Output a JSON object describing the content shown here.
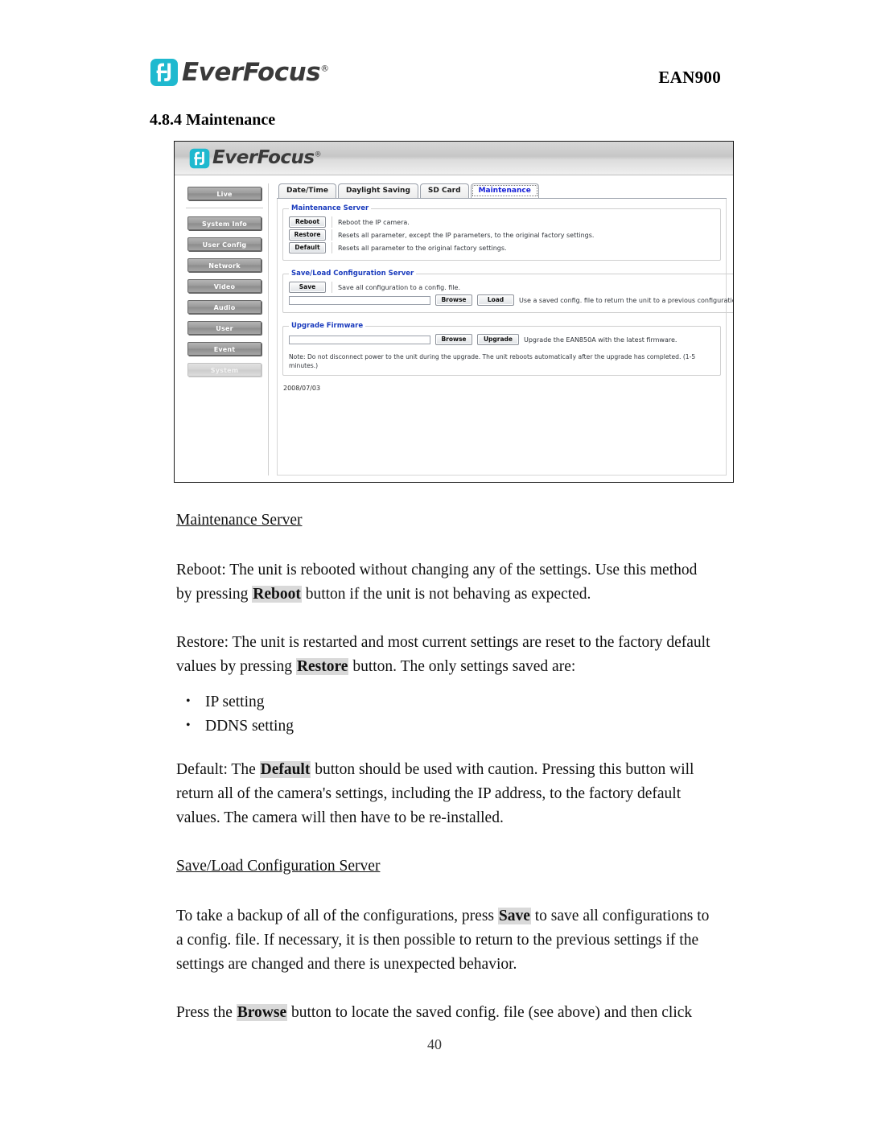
{
  "header": {
    "brand": "EverFocus",
    "brand_registered": "®",
    "model": "EAN900",
    "logo_color": "#1fb9cf"
  },
  "section": {
    "heading": "4.8.4 Maintenance"
  },
  "figure": {
    "app_brand": "EverFocus",
    "app_brand_registered": "®",
    "sidebar": [
      {
        "label": "Live",
        "active": false
      },
      {
        "label": "System Info",
        "active": false
      },
      {
        "label": "User Config",
        "active": false
      },
      {
        "label": "Network",
        "active": false
      },
      {
        "label": "Video",
        "active": false
      },
      {
        "label": "Audio",
        "active": false
      },
      {
        "label": "User",
        "active": false
      },
      {
        "label": "Event",
        "active": false
      },
      {
        "label": "System",
        "active": true
      }
    ],
    "tabs": [
      {
        "label": "Date/Time",
        "active": false
      },
      {
        "label": "Daylight Saving",
        "active": false
      },
      {
        "label": "SD Card",
        "active": false
      },
      {
        "label": "Maintenance",
        "active": true
      }
    ],
    "maintenance_server": {
      "legend": "Maintenance Server",
      "rows": [
        {
          "button": "Reboot",
          "description": "Reboot the IP camera."
        },
        {
          "button": "Restore",
          "description": "Resets all parameter, except the IP parameters, to the original factory settings."
        },
        {
          "button": "Default",
          "description": "Resets all parameter to the original factory settings."
        }
      ]
    },
    "save_load": {
      "legend": "Save/Load Configuration Server",
      "save_button": "Save",
      "save_description": "Save all configuration to a config. file.",
      "file_value": "",
      "browse_button": "Browse",
      "load_button": "Load",
      "load_description": "Use a saved config. file to return the unit to a previous configuration."
    },
    "upgrade": {
      "legend": "Upgrade Firmware",
      "file_value": "",
      "browse_button": "Browse",
      "upgrade_button": "Upgrade",
      "description": "Upgrade the EAN850A with the latest firmware.",
      "note": "Note: Do not disconnect power to the unit during the upgrade. The unit reboots automatically after the upgrade has completed. (1-5 minutes.)"
    },
    "date_stamp": "2008/07/03"
  },
  "body": {
    "maintenance_server_head": "Maintenance Server",
    "reboot_p1": "Reboot: The unit is rebooted without changing any of the settings. Use this method by pressing ",
    "reboot_bold": "Reboot",
    "reboot_p2": " button if the unit is not behaving as expected.",
    "restore_p1": "Restore: The unit is restarted and most current settings are reset to the factory default values by pressing ",
    "restore_bold": "Restore",
    "restore_p2": " button. The only settings saved are:",
    "bullets": [
      "IP setting",
      "DDNS setting"
    ],
    "default_p1": "Default: The ",
    "default_bold": "Default",
    "default_p2": " button should be used with caution. Pressing this button will return all of the camera's settings, including the IP address, to the factory default values. The camera will then have to be re-installed.",
    "save_load_head": "Save/Load Configuration Server",
    "backup_p1": "To take a backup of all of the configurations, press ",
    "backup_bold": "Save",
    "backup_p2": " to save all configurations to a config. file. If necessary, it is then possible to return to the previous settings if the settings are changed and there is unexpected behavior.",
    "browse_p1": "Press the ",
    "browse_bold": "Browse",
    "browse_p2": " button to locate the saved config. file (see above) and then click"
  },
  "footer": {
    "page_number": "40"
  }
}
